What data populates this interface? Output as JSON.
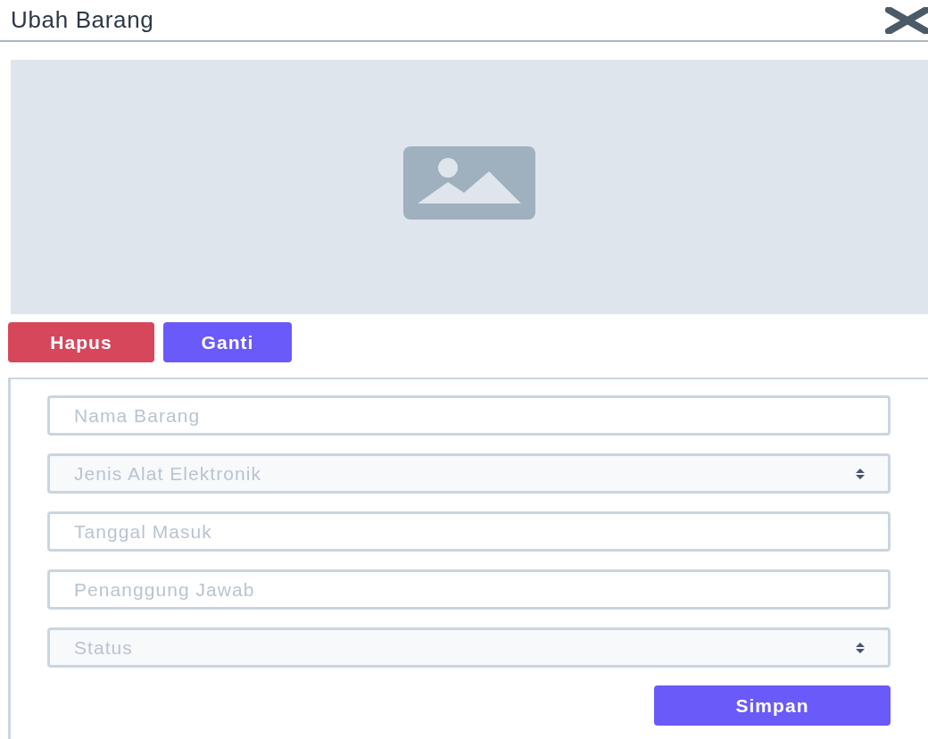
{
  "dialog": {
    "title": "Ubah Barang"
  },
  "image_actions": [
    {
      "label": "Hapus",
      "kind": "danger"
    },
    {
      "label": "Ganti",
      "kind": "primary"
    }
  ],
  "form": {
    "fields": [
      {
        "kind": "input",
        "placeholder": "Nama Barang"
      },
      {
        "kind": "select",
        "placeholder": "Jenis Alat Elektronik"
      },
      {
        "kind": "input",
        "placeholder": "Tanggal Masuk"
      },
      {
        "kind": "input",
        "placeholder": "Penanggung Jawab"
      },
      {
        "kind": "select",
        "placeholder": "Status"
      }
    ],
    "submit": "Simpan"
  }
}
